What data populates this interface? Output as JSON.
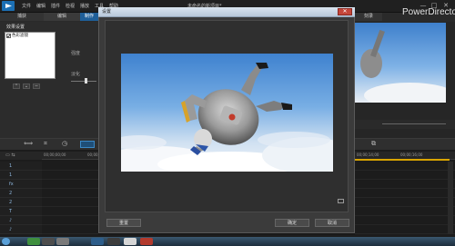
{
  "app": {
    "menu": [
      "文件",
      "编辑",
      "插件",
      "检视",
      "播放",
      "工具",
      "帮助"
    ],
    "project_title": "未命名的新项目*",
    "brand": "PowerDirector",
    "mode_tabs": [
      "捕获",
      "编辑",
      "制作",
      "刻录"
    ],
    "window_controls": {
      "minimize": "—",
      "maximize": "□",
      "close": "✕"
    }
  },
  "left_panel": {
    "title": "效果设置",
    "effects": [
      {
        "name": "色彩滤镜",
        "checked": true
      }
    ],
    "buttons": {
      "up": "⌃",
      "down": "⌄",
      "delete": "−"
    },
    "intensity_label": "强度",
    "fade_label": "淡化"
  },
  "timeline": {
    "ruler_labels": [
      "00;00;00;00",
      "00;00;02;00",
      "00;00;04;00",
      "00;00;06;00",
      "00;00;08;00",
      "00;00;10;00",
      "00;00;12;00",
      "00;00;14;00",
      "00;00;16;00"
    ],
    "tracks": [
      "1",
      "1",
      "fx",
      "2",
      "2",
      "T",
      "♪",
      "♪"
    ]
  },
  "dialog": {
    "title": "设置",
    "close": "✕",
    "buttons": {
      "reset": "重置",
      "ok": "确定",
      "cancel": "取消"
    }
  },
  "colors": {
    "accent": "#3b88c6",
    "timeline_marker": "#d9a400",
    "close_red": "#c5463a"
  }
}
